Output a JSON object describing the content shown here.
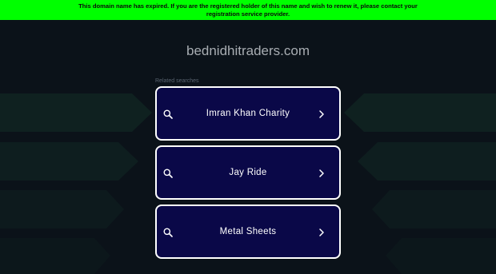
{
  "banner": {
    "text": "This domain name has expired. If you are the registered holder of this name and wish to renew it, please contact your registration service provider."
  },
  "domain": {
    "name": "bednidhitraders.com"
  },
  "related": {
    "label": "Related searches",
    "items": [
      {
        "label": "Imran Khan Charity"
      },
      {
        "label": "Jay Ride"
      },
      {
        "label": "Metal Sheets"
      }
    ]
  },
  "colors": {
    "banner_bg": "#00ff00",
    "page_bg": "#0b1219",
    "card_bg": "#0a0848",
    "card_border": "#ffffff",
    "decor_shape": "#112424"
  },
  "icons": {
    "search": "search-icon",
    "chevron": "chevron-right-icon"
  }
}
